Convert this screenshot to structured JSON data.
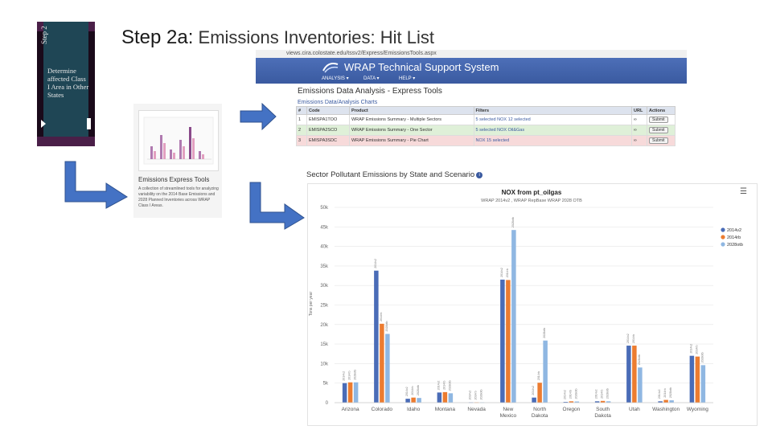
{
  "slide": {
    "title_prefix": "Step 2a:",
    "title_rest": " Emissions Inventories: Hit List"
  },
  "step_card": {
    "vertical_label": "Step 2",
    "description": "Determine affected Class I Area in Other States"
  },
  "browser": {
    "url": "views.cira.colostate.edu/tssv2/Express/EmissionsTools.aspx",
    "app_title": "WRAP Technical Support System",
    "nav": [
      "ANALYSIS ▾",
      "DATA ▾",
      "HELP ▾"
    ]
  },
  "express_tools": {
    "page_title": "Emissions Data Analysis - Express Tools",
    "subtitle": "Emissions Data/Analysis Charts",
    "columns": [
      "#",
      "Code",
      "Product",
      "Filters",
      "URL",
      "Actions"
    ],
    "rows": [
      {
        "num": "1",
        "code": "EMISPA1TOO",
        "product": "WRAP Emissions Summary - Multiple Sectors",
        "filters": "5 selected  NOX  12 selected",
        "action": "Submit"
      },
      {
        "num": "2",
        "code": "EMISPA2SCO",
        "product": "WRAP Emissions Summary - One Sector",
        "filters": "5 selected  NOX  Oil&Gas",
        "action": "Submit"
      },
      {
        "num": "3",
        "code": "EMISPA3SDC",
        "product": "WRAP Emissions Summary - Pie Chart",
        "filters": "NOX  15 selected",
        "action": "Submit"
      }
    ]
  },
  "express_card": {
    "name": "Emissions Express Tools",
    "description": "A collection of streamlined tools for analyzing variability on the 2014 Base Emissions and 2028 Planned Inventories across WRAP Class I Areas."
  },
  "chart_section": {
    "heading": "Sector Pollutant Emissions by State and Scenario",
    "info_icon": "info-icon",
    "menu_icon": "hamburger-menu-icon"
  },
  "chart_data": {
    "type": "bar",
    "title": "NOX from pt_oilgas",
    "subtitle": "WRAP 2014v2 , WRAP RepBase WRAP 2028 OTB",
    "ylabel": "Tons per year",
    "ylim": [
      0,
      50000
    ],
    "yticks": [
      0,
      5000,
      10000,
      15000,
      20000,
      25000,
      30000,
      35000,
      40000,
      45000,
      50000
    ],
    "ytick_labels": [
      "0",
      "5k",
      "10k",
      "15k",
      "20k",
      "25k",
      "30k",
      "35k",
      "40k",
      "45k",
      "50k"
    ],
    "categories": [
      "Arizona",
      "Colorado",
      "Idaho",
      "Montana",
      "Nevada",
      "New Mexico",
      "North Dakota",
      "Oregon",
      "South Dakota",
      "Utah",
      "Washington",
      "Wyoming"
    ],
    "legend_position": "right",
    "series": [
      {
        "name": "2014v2",
        "color": "#4a6cb7",
        "values": [
          5000,
          33800,
          1000,
          2600,
          100,
          31500,
          1300,
          200,
          350,
          14600,
          350,
          12000
        ]
      },
      {
        "name": "2014rb",
        "color": "#ec7c30",
        "values": [
          5200,
          20200,
          1300,
          2700,
          100,
          31400,
          5100,
          350,
          450,
          14600,
          700,
          11800
        ]
      },
      {
        "name": "2028otb",
        "color": "#8fb7e2",
        "values": [
          5200,
          17600,
          1200,
          2400,
          100,
          44200,
          15900,
          300,
          350,
          9000,
          600,
          9600
        ]
      }
    ]
  }
}
